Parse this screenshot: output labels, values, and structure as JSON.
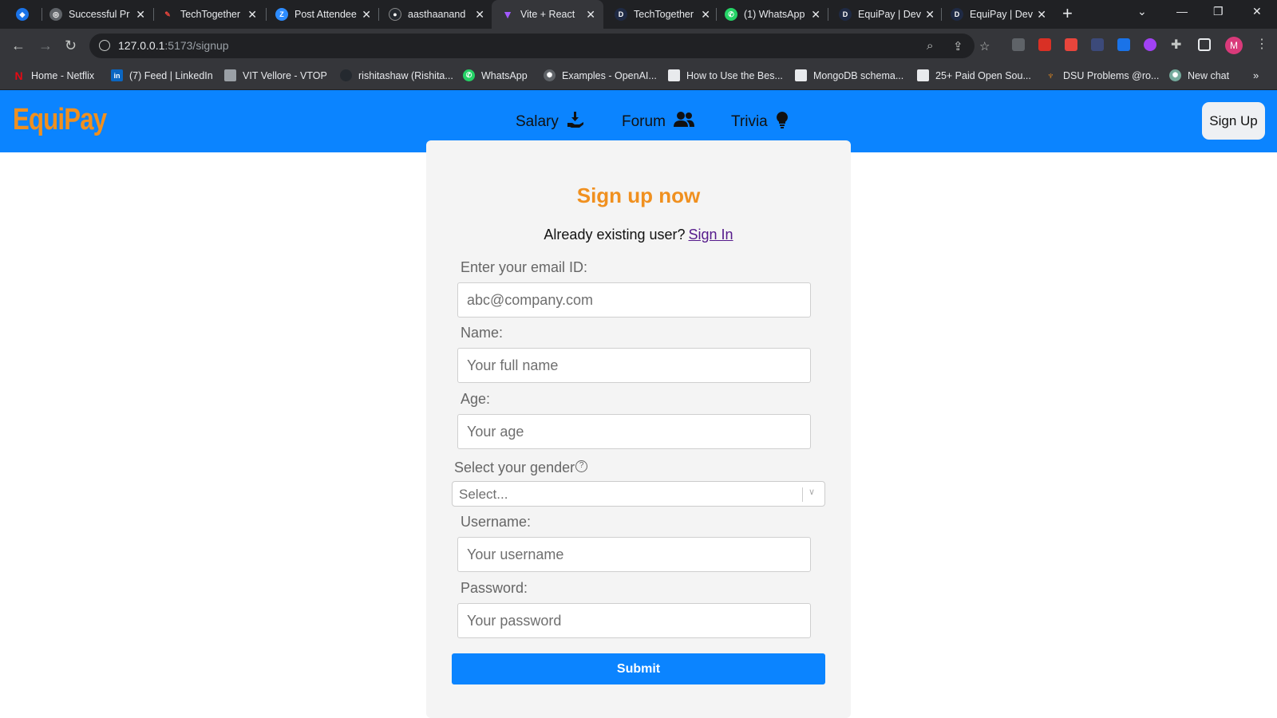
{
  "browser": {
    "tabs": [
      {
        "label": "",
        "color": "#1a73e8",
        "icon": "diamond-icon"
      },
      {
        "label": "Successful Pr",
        "color": "#5f6368",
        "icon": "globe-icon"
      },
      {
        "label": "TechTogether",
        "color": "#e8453c",
        "icon": "techtogether-icon"
      },
      {
        "label": "Post Attendee",
        "color": "#2d8cff",
        "icon": "zoom-icon"
      },
      {
        "label": "aasthaanand",
        "color": "#24292f",
        "icon": "github-icon"
      },
      {
        "label": "Vite + React",
        "color": "#a259ff",
        "icon": "vite-icon"
      },
      {
        "label": "TechTogether",
        "color": "#1f2a44",
        "icon": "devpost-icon"
      },
      {
        "label": "(1) WhatsApp",
        "color": "#25d366",
        "icon": "whatsapp-icon"
      },
      {
        "label": "EquiPay | Dev",
        "color": "#1f2a44",
        "icon": "devpost-icon"
      },
      {
        "label": "EquiPay | Dev",
        "color": "#1f2a44",
        "icon": "devpost-icon"
      }
    ],
    "url_host": "127.0.0.1",
    "url_path": ":5173/signup",
    "bookmarks": [
      {
        "label": "Home - Netflix",
        "color": "#e50914",
        "icon": "netflix-icon"
      },
      {
        "label": "(7) Feed | LinkedIn",
        "color": "#0a66c2",
        "icon": "linkedin-icon"
      },
      {
        "label": "VIT Vellore - VTOP",
        "color": "#9aa0a6",
        "icon": "page-icon"
      },
      {
        "label": "rishitashaw (Rishita...",
        "color": "#24292f",
        "icon": "github-icon"
      },
      {
        "label": "WhatsApp",
        "color": "#25d366",
        "icon": "whatsapp-icon"
      },
      {
        "label": "Examples - OpenAI...",
        "color": "#5f6368",
        "icon": "openai-icon"
      },
      {
        "label": "How to Use the Bes...",
        "color": "#e8eaed",
        "icon": "page-icon"
      },
      {
        "label": "MongoDB schema...",
        "color": "#e8eaed",
        "icon": "page-icon"
      },
      {
        "label": "25+ Paid Open Sou...",
        "color": "#e8eaed",
        "icon": "page-icon"
      },
      {
        "label": "DSU Problems @ro...",
        "color": "#f0901f",
        "icon": "code-icon"
      },
      {
        "label": "New chat",
        "color": "#74aa9c",
        "icon": "openai-icon"
      }
    ],
    "profile_initial": "M",
    "more_bookmarks": "»"
  },
  "app": {
    "logo": "EquiPay",
    "nav": [
      {
        "label": "Salary",
        "icon": "hand-money-icon"
      },
      {
        "label": "Forum",
        "icon": "users-icon"
      },
      {
        "label": "Trivia",
        "icon": "lightbulb-icon"
      }
    ],
    "signup_button": "Sign Up",
    "brand_color": "#0b84ff",
    "accent_color": "#f0901f"
  },
  "form": {
    "title": "Sign up now",
    "existing_text": "Already existing user?",
    "signin_link": "Sign In",
    "email_label": "Enter your email ID:",
    "email_placeholder": "abc@company.com",
    "name_label": "Name:",
    "name_placeholder": "Your full name",
    "age_label": "Age:",
    "age_placeholder": "Your age",
    "gender_label": "Select your gender",
    "gender_select_value": "Select...",
    "username_label": "Username:",
    "username_placeholder": "Your username",
    "password_label": "Password:",
    "password_placeholder": "Your password",
    "submit_label": "Submit"
  }
}
